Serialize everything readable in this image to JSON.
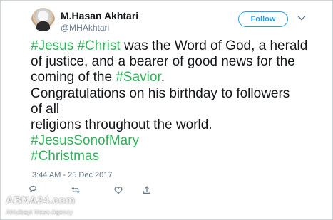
{
  "user": {
    "name": "M.Hasan Akhtari",
    "handle": "@MHAkhtari"
  },
  "follow_button": {
    "label": "Follow",
    "color": "#1da1f2"
  },
  "tweet": {
    "line_1": {
      "tag_1": "#Jesus",
      "tag_2": "#Christ",
      "text": "was the Word of God, a herald"
    },
    "line_2": {
      "text": "of justice, and a bearer of good news for the"
    },
    "line_3": {
      "text_before": "coming of the",
      "tag": "#Savior",
      "text_after": "."
    },
    "line_4": {
      "text": "Congratulations on his birthday to followers"
    },
    "line_5": {
      "text": "of all"
    },
    "line_6": {
      "text": "religions throughout the world."
    },
    "line_7": {
      "tag": "#JesusSonofMary"
    },
    "line_8": {
      "tag": "#Christmas"
    }
  },
  "timestamp": "3:44 AM - 25 Dec 2017",
  "actions": {
    "reply_icon": "reply-icon",
    "retweet_icon": "retweet-icon",
    "like_icon": "like-icon",
    "share_icon": "share-icon"
  },
  "watermark": {
    "logo": "ABNA24.com",
    "subtitle": "Ahlulbayt News Agency"
  },
  "colors": {
    "hashtag": "#2fb35a",
    "text": "#14171a",
    "muted": "#657786",
    "border": "#cfd4d8"
  }
}
